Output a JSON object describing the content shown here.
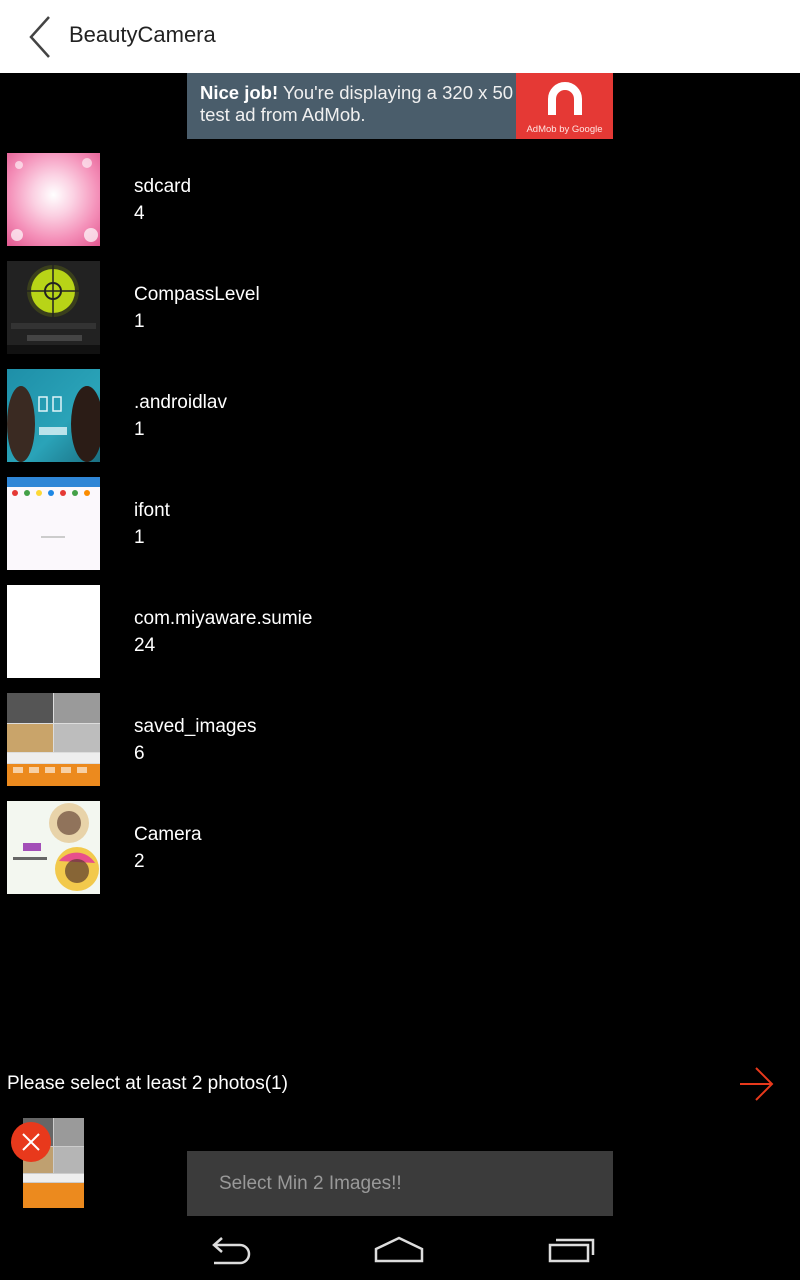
{
  "appbar": {
    "title": "BeautyCamera",
    "back_icon": "chevron-left-icon"
  },
  "ad": {
    "bold_text": "Nice job!",
    "text": " You're displaying a 320 x 50 test ad from AdMob.",
    "logo_text": "AdMob by Google",
    "logo_color": "#e53935"
  },
  "folders": [
    {
      "name": "sdcard",
      "count": "4"
    },
    {
      "name": "CompassLevel",
      "count": "1"
    },
    {
      "name": ".androidlav",
      "count": "1"
    },
    {
      "name": "ifont",
      "count": "1"
    },
    {
      "name": "com.miyaware.sumie",
      "count": "24"
    },
    {
      "name": "saved_images",
      "count": "6"
    },
    {
      "name": "Camera",
      "count": "2"
    }
  ],
  "selection": {
    "message": "Please select at least 2 photos(1)",
    "next_icon": "arrow-right-icon",
    "remove_icon": "close-icon",
    "accent": "#e8391c"
  },
  "toast": {
    "text": "Select Min 2 Images!!"
  },
  "navbar": {
    "back_icon": "nav-back-icon",
    "home_icon": "nav-home-icon",
    "recents_icon": "nav-recents-icon"
  }
}
